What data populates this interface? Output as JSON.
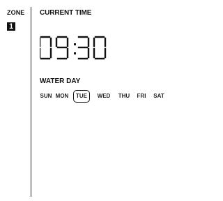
{
  "zone": {
    "label": "ZONE",
    "number": "1"
  },
  "current_time": {
    "label": "CURRENT TIME",
    "value": "09:30"
  },
  "water_day": {
    "label": "WATER DAY",
    "days": [
      "SUN",
      "MON",
      "TUE",
      "WED",
      "THU",
      "FRI",
      "SAT"
    ],
    "selected": "TUE"
  },
  "colors": {
    "foreground": "#111111",
    "background": "#ffffff"
  }
}
